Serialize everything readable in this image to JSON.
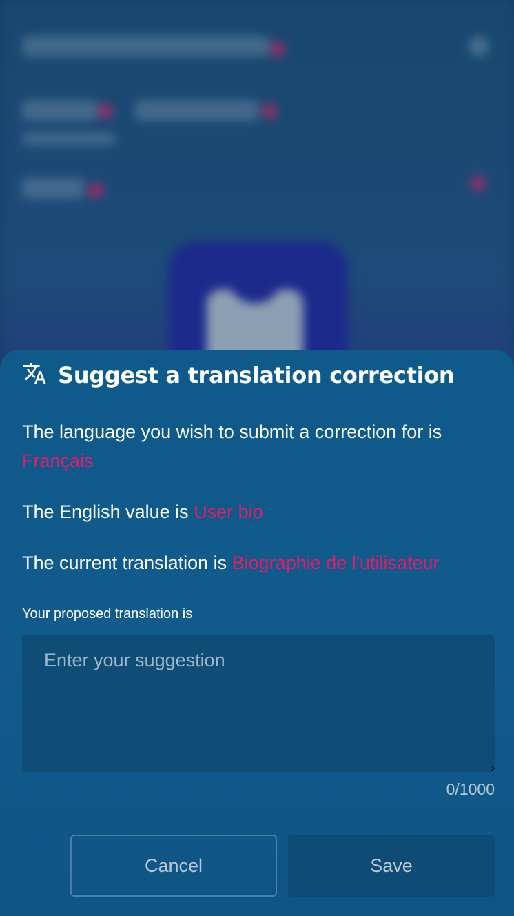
{
  "background": {
    "blurred": true
  },
  "dialog": {
    "title": "Suggest a translation correction",
    "icon": "translate-icon",
    "language_prefix": "The language you wish to submit a correction for is",
    "language_value": "Français",
    "english_prefix": "The English value is",
    "english_value": "User bio",
    "current_prefix": "The current translation is",
    "current_value": "Biographie de l'utilisateur",
    "proposed_label": "Your proposed translation is",
    "input_value": "",
    "input_placeholder": "Enter your suggestion",
    "counter": "0/1000",
    "cancel_label": "Cancel",
    "save_label": "Save"
  },
  "colors": {
    "accent": "#e11d69",
    "sheet": "#115b8c",
    "input_bg": "#0f4d77"
  }
}
